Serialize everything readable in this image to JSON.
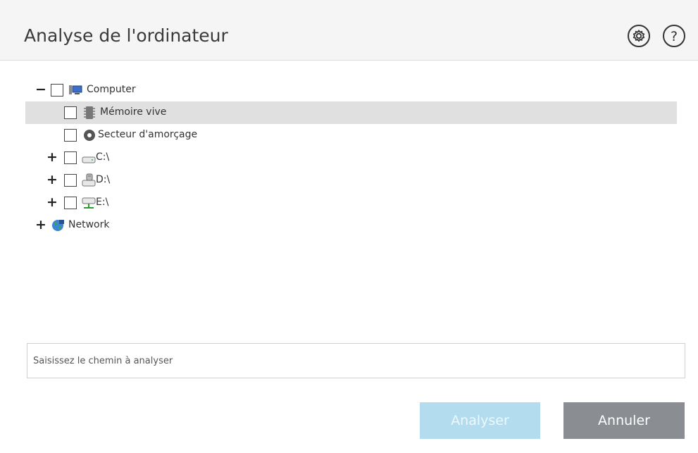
{
  "header": {
    "title": "Analyse de l'ordinateur",
    "icons": [
      "gear-icon",
      "help-icon"
    ]
  },
  "tree": {
    "items": [
      {
        "label": "Computer",
        "icon": "computer-icon",
        "expander": "−",
        "checked": false,
        "selected": false
      },
      {
        "label": "Mémoire vive",
        "icon": "memory-chip-icon",
        "expander": "",
        "checked": false,
        "selected": true
      },
      {
        "label": "Secteur d'amorçage",
        "icon": "disc-icon",
        "expander": "",
        "checked": false,
        "selected": false
      },
      {
        "label": "C:\\",
        "icon": "hard-drive-icon",
        "expander": "+",
        "checked": false,
        "selected": false
      },
      {
        "label": "D:\\",
        "icon": "removable-drive-icon",
        "expander": "+",
        "checked": false,
        "selected": false
      },
      {
        "label": "E:\\",
        "icon": "network-drive-icon",
        "expander": "+",
        "checked": false,
        "selected": false
      },
      {
        "label": "Network",
        "icon": "network-globe-icon",
        "expander": "+",
        "checked": false,
        "selected": false
      }
    ]
  },
  "path_input": {
    "placeholder": "Saisissez le chemin à analyser",
    "value": ""
  },
  "buttons": {
    "scan_label": "Analyser",
    "cancel_label": "Annuler"
  },
  "colors": {
    "scan_button": "#b3dcef",
    "cancel_button": "#8a8d91",
    "selected_row": "#e0e0e0"
  }
}
